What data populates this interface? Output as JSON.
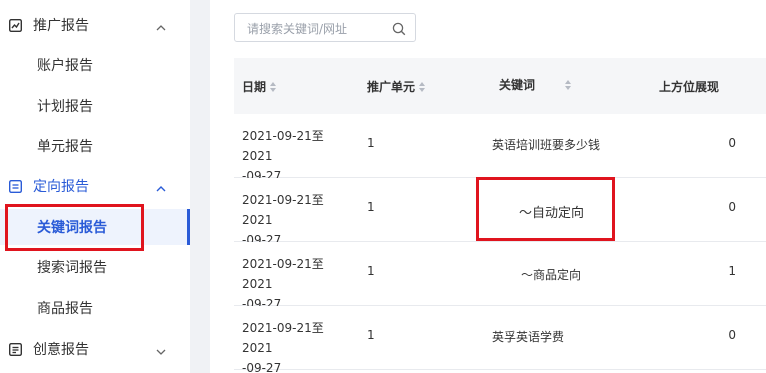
{
  "sidebar": {
    "groups": [
      {
        "label": "推广报告",
        "icon": "chart-icon",
        "expanded": true
      },
      {
        "label": "定向报告",
        "icon": "list-icon",
        "expanded": true
      },
      {
        "label": "创意报告",
        "icon": "document-icon",
        "expanded": false
      }
    ],
    "promo_items": [
      "账户报告",
      "计划报告",
      "单元报告"
    ],
    "targeting_items": [
      "关键词报告",
      "搜索词报告",
      "商品报告"
    ],
    "active_item": "关键词报告",
    "accent_color": "#2a5bd7",
    "highlight_color": "#e0141e"
  },
  "search": {
    "placeholder": "请搜索关键词/网址",
    "icon": "search-icon"
  },
  "table": {
    "headers": [
      "日期",
      "推广单元",
      "关键词",
      "上方位展现"
    ],
    "rows": [
      {
        "date_line1": "2021-09-21至2021",
        "date_line2": "-09-27",
        "unit": "1",
        "keyword": "英语培训班要多少钱",
        "top_impressions": "0"
      },
      {
        "date_line1": "2021-09-21至2021",
        "date_line2": "-09-27",
        "unit": "1",
        "keyword": "～自动定向",
        "top_impressions": "0"
      },
      {
        "date_line1": "2021-09-21至2021",
        "date_line2": "-09-27",
        "unit": "1",
        "keyword": "～商品定向",
        "top_impressions": "1"
      },
      {
        "date_line1": "2021-09-21至2021",
        "date_line2": "-09-27",
        "unit": "1",
        "keyword": "英孚英语学费",
        "top_impressions": "0"
      }
    ]
  }
}
